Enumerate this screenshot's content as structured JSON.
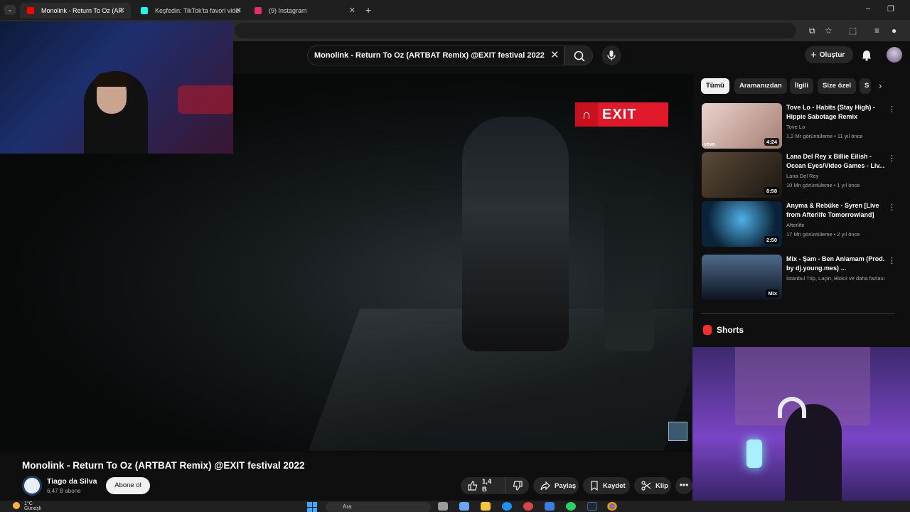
{
  "browser": {
    "tabs": [
      {
        "title": "Monolink - Return To Oz (ARTBAT",
        "favicon_color": "#ff0000",
        "active": true
      },
      {
        "title": "Keşfedin: TikTok'ta favori videol",
        "favicon_color": "#25f4ee",
        "active": false
      },
      {
        "title": "(9) Instagram",
        "favicon_color": "#e1306c",
        "active": false
      }
    ],
    "new_tab_glyph": "+"
  },
  "header": {
    "search_query": "Monolink - Return To Oz (ARTBAT Remix) @EXIT festival 2022",
    "create_label": "Oluştur"
  },
  "video": {
    "overlay_logo": "EXIT",
    "title": "Monolink - Return To Oz (ARTBAT Remix) @EXIT festival 2022",
    "channel_name": "Tiago da Silva",
    "subscribers": "6,47 B abone",
    "subscribe_label": "Abone ol",
    "like_count": "1,4 B",
    "share_label": "Paylaş",
    "save_label": "Kaydet",
    "clip_label": "Klip",
    "more_glyph": "•••"
  },
  "sidebar": {
    "chips": [
      "Tümü",
      "Aramanızdan",
      "İlgili",
      "Size özel",
      "S"
    ],
    "recommendations": [
      {
        "title": "Tove Lo - Habits (Stay High) - Hippie Sabotage Remix",
        "channel": "Tove Lo",
        "meta": "1,2 Mr görüntüleme • 11 yıl önce",
        "duration": "4:24",
        "badge": "vevo",
        "thumb_colors": [
          "#e9d4cf",
          "#a57e72"
        ]
      },
      {
        "title": "Lana Del Rey x Billie Eilish - Ocean Eyes/Video Games - Liv...",
        "channel": "Lana Del Rey",
        "meta": "10 Mn görüntüleme • 1 yıl önce",
        "duration": "8:58",
        "badge": "",
        "thumb_colors": [
          "#5b4a38",
          "#1c1711"
        ]
      },
      {
        "title": "Anyma & Rebūke - Syren [Live from Afterlife Tomorrowland]",
        "channel": "Afterlife",
        "meta": "17 Mn görüntüleme • 2 yıl önce",
        "duration": "2:50",
        "badge": "",
        "thumb_colors": [
          "#4fb0e6",
          "#0b2338"
        ]
      },
      {
        "title": "Mix - Şam - Ben Anlamam (Prod. by dj.young.mes) ...",
        "channel": "İstanbul Trip, Laçin, Blok3 ve daha fazlası",
        "meta": "",
        "duration": "Mix",
        "badge": "",
        "thumb_colors": [
          "#4d6a8a",
          "#0e1420"
        ]
      }
    ],
    "shorts_label": "Shorts"
  },
  "taskbar": {
    "temperature": "1°C",
    "weather_text": "Güneşli",
    "search_label": "Ara"
  }
}
